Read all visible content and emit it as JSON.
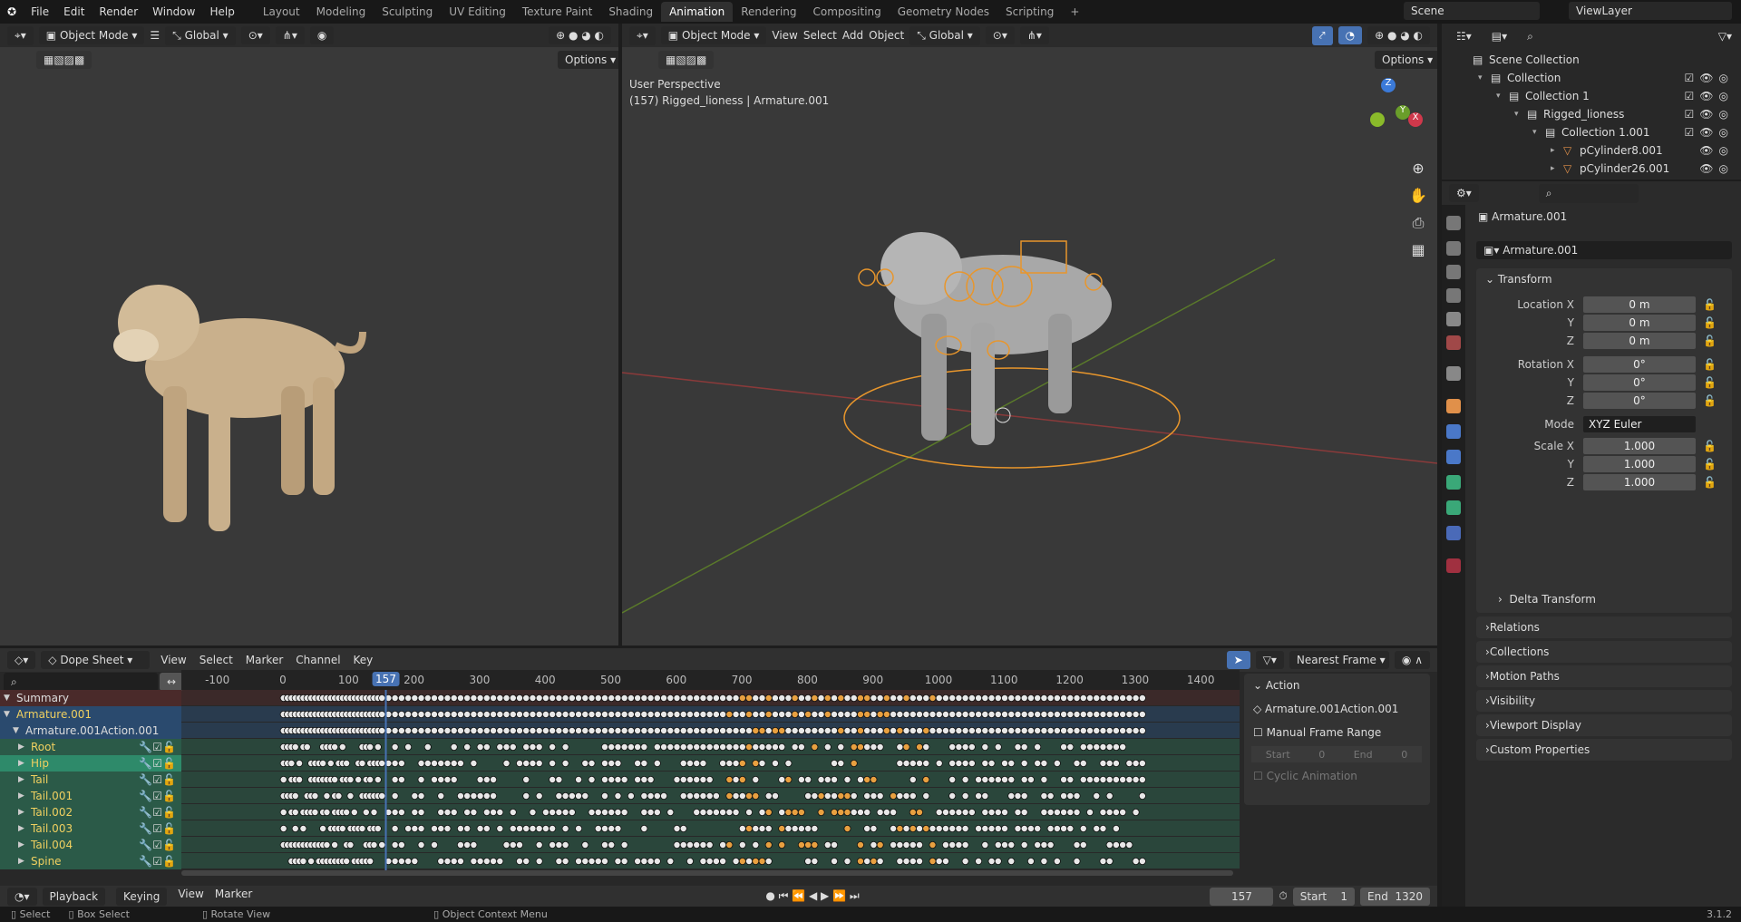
{
  "topbar": {
    "menus": [
      "File",
      "Edit",
      "Render",
      "Window",
      "Help"
    ],
    "workspaces": [
      "Layout",
      "Modeling",
      "Sculpting",
      "UV Editing",
      "Texture Paint",
      "Shading",
      "Animation",
      "Rendering",
      "Compositing",
      "Geometry Nodes",
      "Scripting"
    ],
    "active_workspace": "Animation",
    "add_label": "+",
    "scene": "Scene",
    "view_layer": "ViewLayer"
  },
  "left_viewport": {
    "mode": "Object Mode",
    "orientation": "Global",
    "options": "Options"
  },
  "right_viewport": {
    "mode": "Object Mode",
    "menus": [
      "View",
      "Select",
      "Add",
      "Object"
    ],
    "orientation": "Global",
    "options": "Options",
    "overlay_line1": "User Perspective",
    "overlay_line2": "(157) Rigged_lioness | Armature.001",
    "gizmo": {
      "z": "Z",
      "y": "Y",
      "x": "X"
    }
  },
  "outliner": {
    "items": [
      {
        "label": "Scene Collection",
        "depth": 0
      },
      {
        "label": "Collection",
        "depth": 1
      },
      {
        "label": "Collection 1",
        "depth": 2
      },
      {
        "label": "Rigged_lioness",
        "depth": 3
      },
      {
        "label": "Collection 1.001",
        "depth": 4
      },
      {
        "label": "pCylinder8.001",
        "depth": 5
      },
      {
        "label": "pCylinder26.001",
        "depth": 5
      }
    ]
  },
  "properties": {
    "object_name": "Armature.001",
    "datablock": "Armature.001",
    "transform_title": "Transform",
    "fields": [
      {
        "label": "Location X",
        "value": "0 m"
      },
      {
        "label": "Y",
        "value": "0 m"
      },
      {
        "label": "Z",
        "value": "0 m"
      },
      {
        "label": "Rotation X",
        "value": "0°"
      },
      {
        "label": "Y",
        "value": "0°"
      },
      {
        "label": "Z",
        "value": "0°"
      },
      {
        "label": "Mode",
        "value": "XYZ Euler"
      },
      {
        "label": "Scale X",
        "value": "1.000"
      },
      {
        "label": "Y",
        "value": "1.000"
      },
      {
        "label": "Z",
        "value": "1.000"
      }
    ],
    "delta": "Delta Transform",
    "sections": [
      "Relations",
      "Collections",
      "Motion Paths",
      "Visibility",
      "Viewport Display",
      "Custom Properties"
    ]
  },
  "dopesheet": {
    "editor": "Dope Sheet",
    "menus": [
      "View",
      "Select",
      "Marker",
      "Channel",
      "Key"
    ],
    "snap": "Nearest Frame",
    "current_frame": "157",
    "ticks": [
      "-100",
      "0",
      "100",
      "200",
      "300",
      "400",
      "500",
      "600",
      "700",
      "800",
      "900",
      "1000",
      "1100",
      "1200",
      "1300",
      "1400"
    ],
    "channels": [
      "Summary",
      "Armature.001",
      "Armature.001Action.001",
      "Root",
      "Hip",
      "Tail",
      "Tail.001",
      "Tail.002",
      "Tail.003",
      "Tail.004",
      "Spine"
    ],
    "action_panel": {
      "title": "Action",
      "action": "Armature.001Action.001",
      "manual": "Manual Frame Range",
      "start_label": "Start",
      "start": "0",
      "end_label": "End",
      "end": "0",
      "cyclic": "Cyclic Animation"
    }
  },
  "timeline": {
    "menus": [
      "Playback",
      "Keying",
      "View",
      "Marker"
    ],
    "frame": "157",
    "start_label": "Start",
    "start": "1",
    "end_label": "End",
    "end": "1320"
  },
  "status": {
    "select": "Select",
    "box_select": "Box Select",
    "rotate": "Rotate View",
    "context": "Object Context Menu",
    "version": "3.1.2"
  },
  "colors": {
    "accent": "#4772b3",
    "summary": "#4a2a2a",
    "armature": "#2a4a6e",
    "channel": "#2b5a48",
    "bone_text": "#f0d060",
    "selected_key": "#e8a040"
  }
}
